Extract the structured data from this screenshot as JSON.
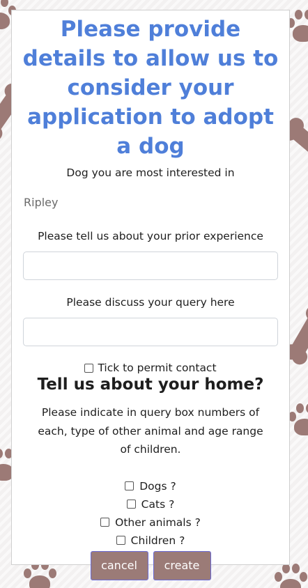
{
  "form": {
    "heading": "Please provide details to allow us to consider your application to adopt a dog",
    "dog_label": "Dog you are most interested in",
    "dog_value": "Ripley",
    "experience_label": "Please tell us about your prior experience",
    "experience_value": "",
    "query_label": "Please discuss your query here",
    "query_value": "",
    "contact_label": "Tick to permit contact",
    "home_title": "Tell us about your home?",
    "instructions": "Please indicate in query box numbers of each, type of other animal and age range of children.",
    "checks": [
      {
        "label": "Dogs ?",
        "checked": false
      },
      {
        "label": "Cats ?",
        "checked": false
      },
      {
        "label": "Other animals ?",
        "checked": false
      },
      {
        "label": "Children ?",
        "checked": false
      }
    ],
    "cancel_label": "cancel",
    "create_label": "create"
  },
  "colors": {
    "heading": "#4f7fd9",
    "button": "#9b7b77",
    "decoration": "#9c7a76"
  }
}
